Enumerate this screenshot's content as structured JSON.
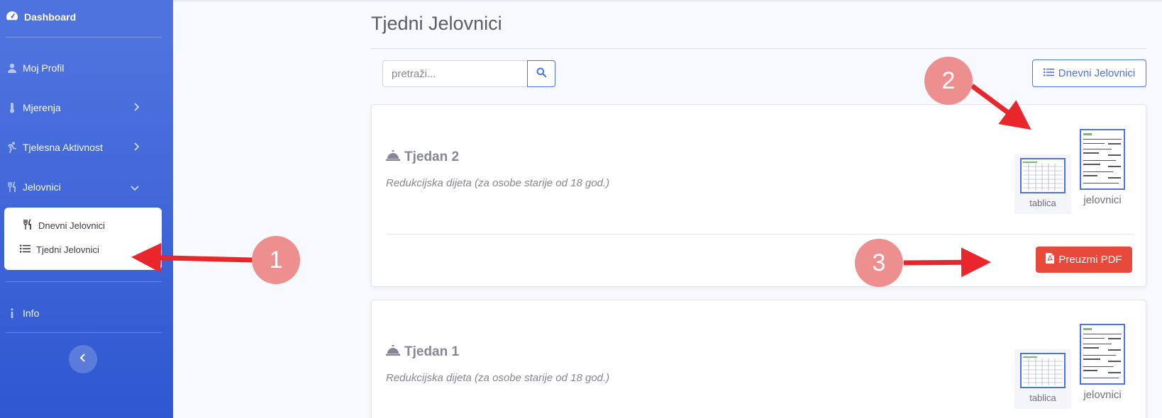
{
  "sidebar": {
    "brand": "Dashboard",
    "items": [
      {
        "label": "Moj Profil",
        "icon": "user-icon"
      },
      {
        "label": "Mjerenja",
        "icon": "thermometer-icon"
      },
      {
        "label": "Tjelesna Aktivnost",
        "icon": "running-icon"
      },
      {
        "label": "Jelovnici",
        "icon": "utensils-icon"
      }
    ],
    "submenu": [
      {
        "label": "Dnevni Jelovnici",
        "icon": "utensils-icon"
      },
      {
        "label": "Tjedni Jelovnici",
        "icon": "list-icon"
      }
    ],
    "info": "Info"
  },
  "page": {
    "title": "Tjedni Jelovnici",
    "search_placeholder": "pretraži...",
    "daily_button": "Dnevni Jelovnici"
  },
  "cards": [
    {
      "title": "Tjedan 2",
      "subtitle": "Redukcijska dijeta (za osobe starije od 18 god.)",
      "thumb_small": "tablica",
      "thumb_large": "jelovnici",
      "pdf_button": "Preuzmi PDF"
    },
    {
      "title": "Tjedan 1",
      "subtitle": "Redukcijska dijeta (za osobe starije od 18 god.)",
      "thumb_small": "tablica",
      "thumb_large": "jelovnici"
    }
  ],
  "annotations": {
    "m1": "1",
    "m2": "2",
    "m3": "3"
  },
  "colors": {
    "primary": "#4e73df",
    "danger": "#e74a3b",
    "annotation": "#ee8f8f",
    "arrow": "#e8262c"
  }
}
